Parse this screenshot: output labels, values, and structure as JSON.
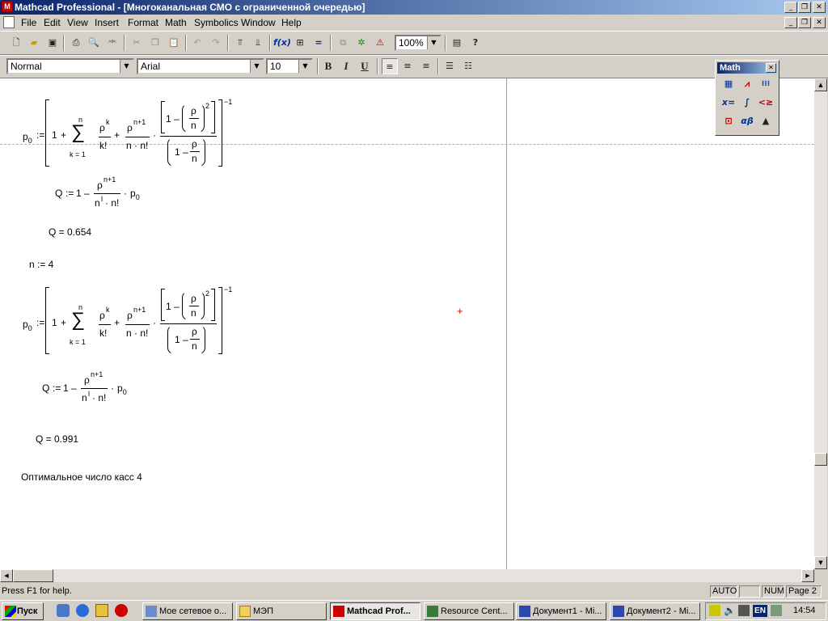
{
  "window": {
    "title": "Mathcad Professional - [Многоканальная СМО с ограниченной очередью]",
    "app_icon": "mathcad-icon",
    "min_glyph": "_",
    "max_glyph": "❐",
    "close_glyph": "✕"
  },
  "menu": [
    "File",
    "Edit",
    "View",
    "Insert",
    "Format",
    "Math",
    "Symbolics",
    "Window",
    "Help"
  ],
  "standard_toolbar": {
    "zoom": "100%",
    "icons": [
      "new-icon",
      "open-icon",
      "save-icon",
      "print-icon",
      "print-preview-icon",
      "spell-check-icon",
      "cut-icon",
      "copy-icon",
      "paste-icon",
      "undo-icon",
      "redo-icon",
      "align-across-icon",
      "align-down-icon",
      "insert-function-icon",
      "insert-unit-icon",
      "calculate-icon",
      "insert-component-icon",
      "resource-center-icon",
      "resource-icon",
      "zoom-icon",
      "help-icon"
    ]
  },
  "formatting_toolbar": {
    "style": "Normal",
    "font": "Arial",
    "size": "10",
    "bold": "B",
    "italic": "I",
    "underline": "U"
  },
  "math_palette": {
    "title": "Math",
    "close_glyph": "✕",
    "icons": [
      "calculator-icon",
      "graph-icon",
      "matrix-icon",
      "evaluation-icon",
      "calculus-icon",
      "boolean-icon",
      "programming-icon",
      "greek-icon",
      "symbolic-icon"
    ],
    "labels": [
      "▦",
      "⩘",
      "⁝⁝⁝",
      "x=",
      "∫",
      "<≥",
      "⊡",
      "αβ",
      "▲"
    ]
  },
  "worksheet": {
    "p0_lhs": "p",
    "p0_sub": "0",
    "assign": ":=",
    "one": "1",
    "plus": "+",
    "minus": "–",
    "dot": "·",
    "sum": "∑",
    "sum_top": "n",
    "sum_bottom": "k = 1",
    "rho": "ρ",
    "k": "k",
    "k_fact": "k!",
    "n1": "n+1",
    "n_dot_nf": "n · n!",
    "n": "n",
    "sq": "2",
    "neg1": "−1",
    "q_lhs": "Q",
    "q_den_a": "n",
    "q_den_sup": "l",
    "q_den_b": "· n!",
    "q_result1": "Q = 0.654",
    "n_assign": "n := 4",
    "q_result2": "Q = 0.991",
    "conclusion": "Оптимальное число касс 4"
  },
  "status": {
    "help": "Press F1 for help.",
    "auto": "AUTO",
    "num": "NUM",
    "page": "Page 2"
  },
  "taskbar": {
    "start": "Пуск",
    "buttons": [
      {
        "label": "Мое сетевое о...",
        "icon": "network-icon"
      },
      {
        "label": "МЭП",
        "icon": "folder-icon"
      },
      {
        "label": "Mathcad Prof...",
        "icon": "mathcad-icon"
      },
      {
        "label": "Resource Cent...",
        "icon": "resource-center-icon"
      },
      {
        "label": "Документ1 - Mi...",
        "icon": "word-icon"
      },
      {
        "label": "Документ2 - Mi...",
        "icon": "word-icon"
      }
    ],
    "lang": "EN",
    "clock": "14:54"
  }
}
